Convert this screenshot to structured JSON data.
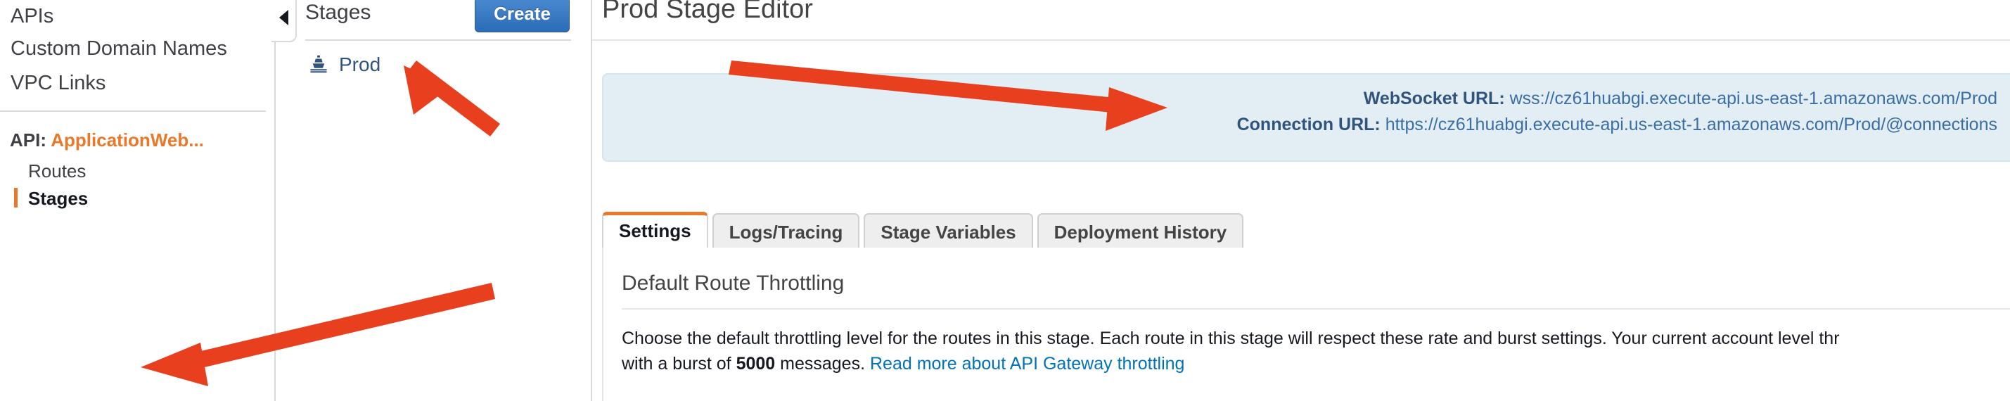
{
  "sidebar": {
    "items": [
      {
        "label": "APIs",
        "name": "sidebar-item-apis"
      },
      {
        "label": "Custom Domain Names",
        "name": "sidebar-item-custom-domain-names"
      },
      {
        "label": "VPC Links",
        "name": "sidebar-item-vpc-links"
      }
    ],
    "api_section": {
      "prefix": "API: ",
      "api_name": "ApplicationWeb...",
      "sub_items": [
        {
          "label": "Routes",
          "selected": false
        },
        {
          "label": "Stages",
          "selected": true
        }
      ]
    },
    "collapse_icon": "chevron-left-icon"
  },
  "stages_panel": {
    "title": "Stages",
    "create_label": "Create",
    "stage": {
      "label": "Prod",
      "icon": "ship-icon"
    }
  },
  "editor": {
    "title": "Prod Stage Editor",
    "urls": [
      {
        "key": "WebSocket URL:",
        "value": "wss://cz61huabgi.execute-api.us-east-1.amazonaws.com/Prod"
      },
      {
        "key": "Connection URL:",
        "value": "https://cz61huabgi.execute-api.us-east-1.amazonaws.com/Prod/@connections"
      }
    ],
    "tabs": [
      {
        "label": "Settings",
        "active": true
      },
      {
        "label": "Logs/Tracing",
        "active": false
      },
      {
        "label": "Stage Variables",
        "active": false
      },
      {
        "label": "Deployment History",
        "active": false
      }
    ],
    "settings": {
      "section_title": "Default Route Throttling",
      "description_part1": "Choose the default throttling level for the routes in this stage. Each route in this stage will respect these rate and burst settings. Your current account level thr",
      "description_part2": "with a burst of ",
      "burst_value": "5000",
      "description_part3": " messages. ",
      "link_label": "Read more about API Gateway throttling"
    }
  },
  "colors": {
    "accent_orange": "#e8792b",
    "link_blue": "#0073bb",
    "annotation_red": "#e8401f",
    "info_panel_bg": "#e2edf4",
    "create_button_blue": "#2a6cb6"
  }
}
